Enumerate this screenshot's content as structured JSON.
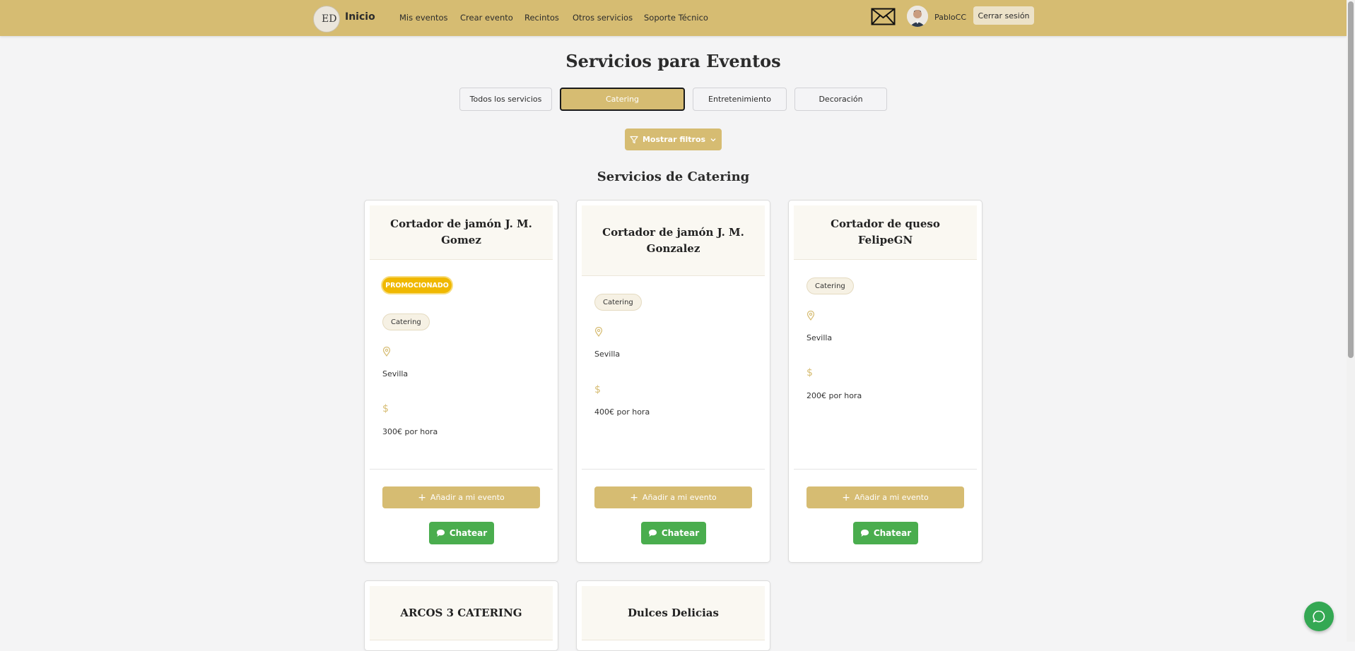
{
  "nav": {
    "brand": "Inicio",
    "logo_text": "ED",
    "links": [
      "Mis eventos",
      "Crear evento",
      "Recintos",
      "Otros servicios",
      "Soporte Técnico"
    ],
    "username": "PabloCC",
    "logout": "Cerrar sesión"
  },
  "page": {
    "title": "Servicios para Eventos",
    "tabs": [
      "Todos los servicios",
      "Catering",
      "Entretenimiento",
      "Decoración"
    ],
    "active_tab": "Catering",
    "filter_button": "Mostrar filtros",
    "section_title": "Servicios de Catering"
  },
  "cards": [
    {
      "name": "Cortador de jamón J. M. Gomez",
      "promo": "PROMOCIONADO",
      "category": "Catering",
      "location": "Sevilla",
      "price": "300€ por hora",
      "add_label": "Añadir a mi evento",
      "chat_label": "Chatear"
    },
    {
      "name": "Cortador de jamón J. M. Gonzalez",
      "category": "Catering",
      "location": "Sevilla",
      "price": "400€ por hora",
      "add_label": "Añadir a mi evento",
      "chat_label": "Chatear"
    },
    {
      "name": "Cortador de queso FelipeGN",
      "category": "Catering",
      "location": "Sevilla",
      "price": "200€ por hora",
      "add_label": "Añadir a mi evento",
      "chat_label": "Chatear"
    },
    {
      "name": "ARCOS 3 CATERING"
    },
    {
      "name": "Dulces Delicias"
    }
  ],
  "icons": {
    "mail": "mail-icon",
    "filter": "funnel-icon",
    "location": "map-pin-icon",
    "price": "dollar-icon",
    "add": "plus-icon",
    "chat": "speech-bubble-icon"
  },
  "colors": {
    "accent": "#d6bc72",
    "chat_green": "#4aad4e",
    "promo_yellow": "#f0b800"
  }
}
